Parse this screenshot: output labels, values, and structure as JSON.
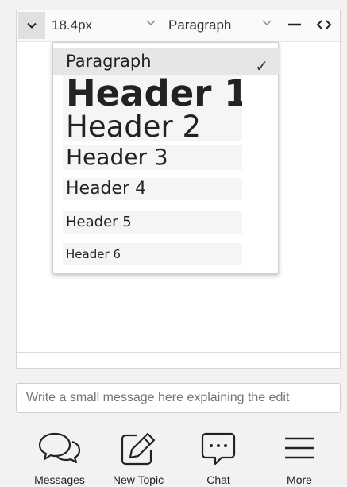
{
  "toolbar": {
    "font_size": "18.4px",
    "block_format": "Paragraph"
  },
  "format_menu": {
    "items": [
      {
        "label": "Paragraph",
        "selected": true
      },
      {
        "label": "Header 1"
      },
      {
        "label": "Header 2"
      },
      {
        "label": "Header 3"
      },
      {
        "label": "Header 4"
      },
      {
        "label": "Header 5"
      },
      {
        "label": "Header 6"
      }
    ],
    "check_mark": "✓"
  },
  "edit_summary": {
    "placeholder": "Write a small message here explaining the edit"
  },
  "bottom_nav": {
    "items": [
      {
        "label": "Messages",
        "icon": "messages-icon"
      },
      {
        "label": "New Topic",
        "icon": "new-topic-icon"
      },
      {
        "label": "Chat",
        "icon": "chat-icon"
      },
      {
        "label": "More",
        "icon": "menu-icon"
      }
    ]
  }
}
